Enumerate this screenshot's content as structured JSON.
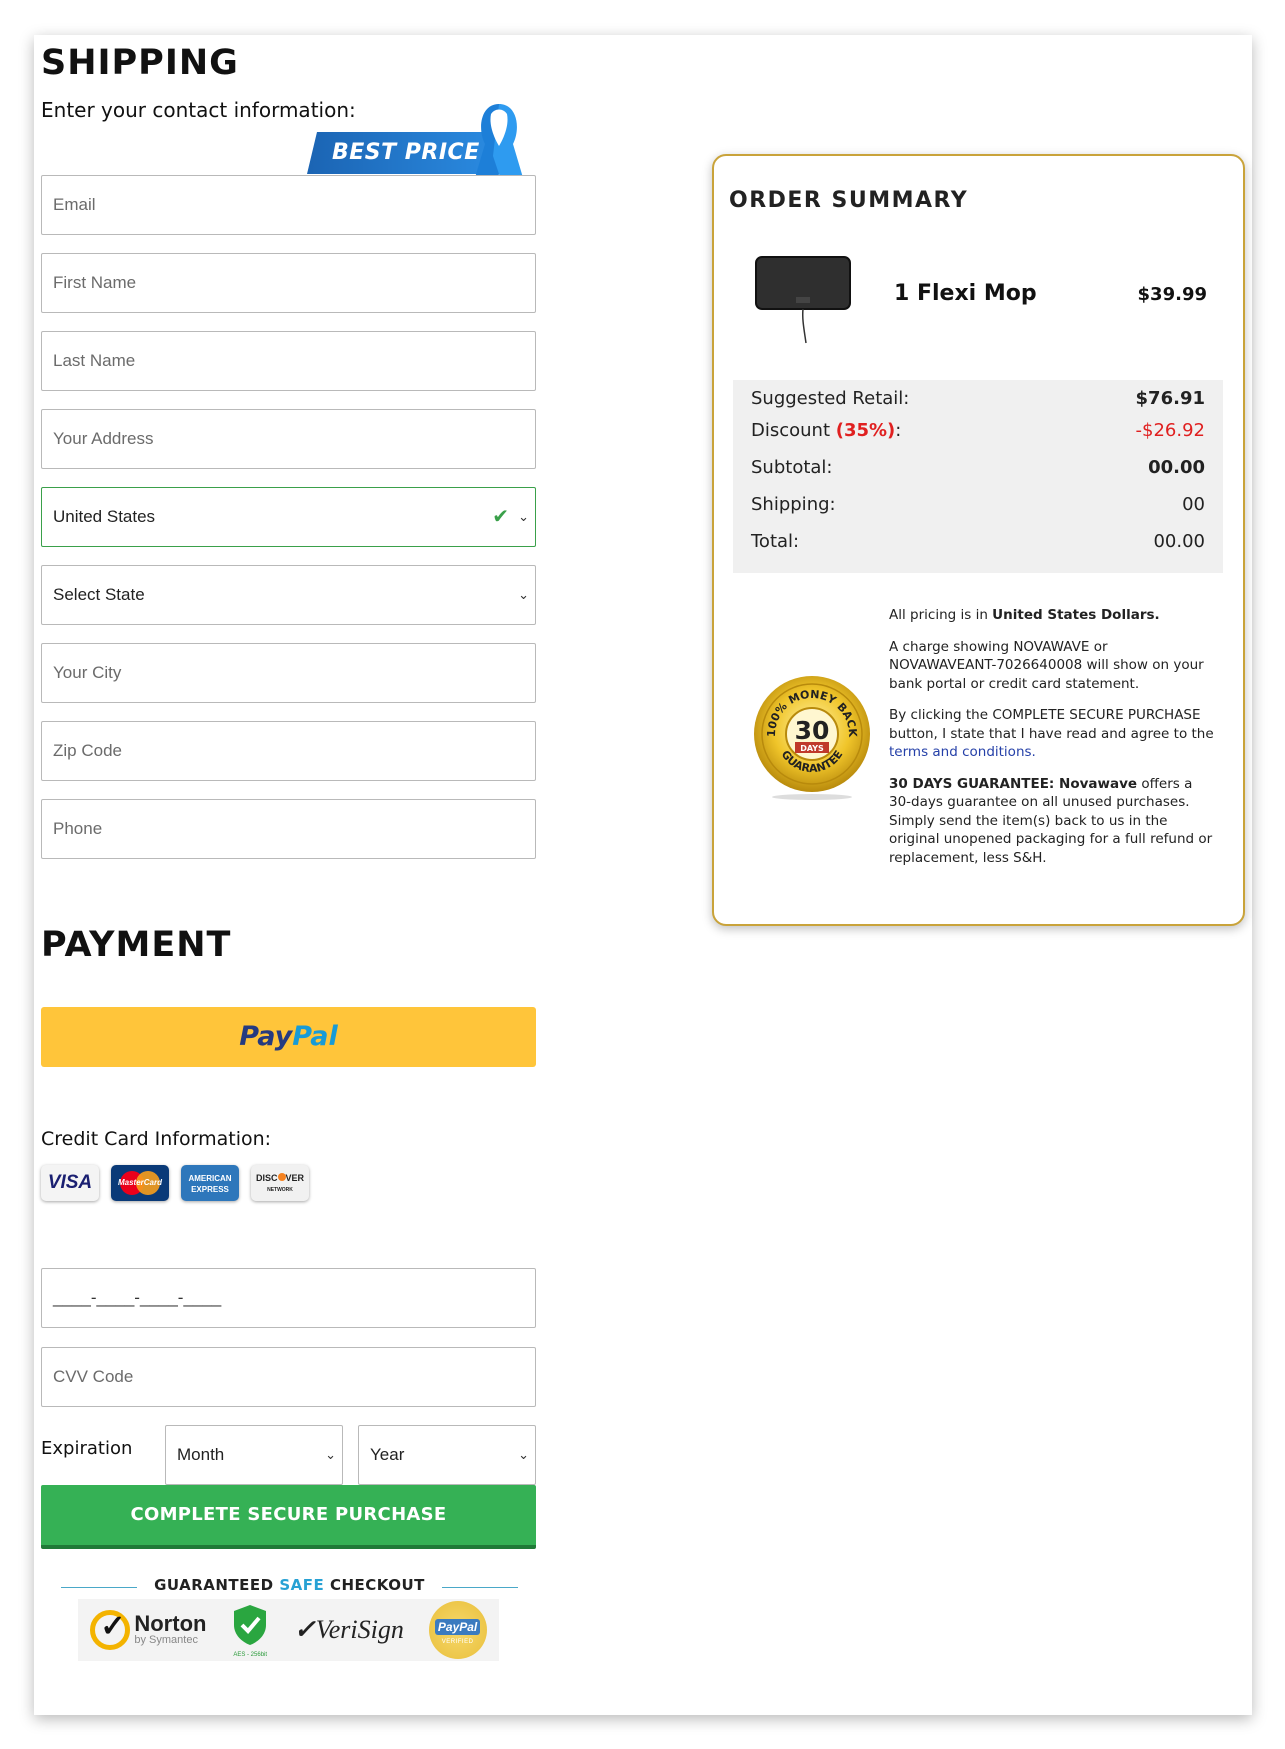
{
  "shipping": {
    "heading": "SHIPPING",
    "subtitle": "Enter your contact information:",
    "best_price": "BEST PRICE",
    "fields": {
      "email": "Email",
      "first_name": "First Name",
      "last_name": "Last Name",
      "address": "Your Address",
      "country": "United States",
      "state": "Select State",
      "city": "Your City",
      "zip": "Zip Code",
      "phone": "Phone"
    }
  },
  "payment": {
    "heading": "PAYMENT",
    "paypal_a": "Pay",
    "paypal_b": "Pal",
    "cc_label": "Credit Card Information:",
    "cards": [
      "VISA",
      "MasterCard",
      "AMERICAN EXPRESS",
      "DISCOVER"
    ],
    "amex_line1": "AMERICAN",
    "amex_line2": "EXPRESS",
    "discover_line1": "DISC",
    "discover_line2": "VER",
    "discover_sub": "NETWORK",
    "card_number_mask": "____-____-____-____",
    "cvv": "CVV Code",
    "expiration_label": "Expiration",
    "month": "Month",
    "year": "Year",
    "submit": "COMPLETE SECURE PURCHASE",
    "guaranteed_a": "GUARANTEED ",
    "guaranteed_safe": "SAFE",
    "guaranteed_b": " CHECKOUT",
    "trust": {
      "norton": "Norton",
      "norton_by": "by Symantec",
      "aes": "AES - 256bit",
      "verisign_a": "Veri",
      "verisign_b": "Sign",
      "paypal_verified_a": "PayPal",
      "paypal_verified_b": "VERIFIED"
    }
  },
  "summary": {
    "title": "ORDER SUMMARY",
    "product_name": "1 Flexi Mop",
    "product_price": "$39.99",
    "suggested_label": "Suggested Retail:",
    "suggested_value": "$76.91",
    "discount_label": "Discount ",
    "discount_pct": "(35%)",
    "discount_colon": ":",
    "discount_value": "-$26.92",
    "subtotal_label": "Subtotal:",
    "subtotal_value": "00.00",
    "shipping_label": "Shipping:",
    "shipping_value": "00",
    "total_label": "Total:",
    "total_value": "00.00",
    "badge": {
      "top": "100% MONEY BACK",
      "days_num": "30",
      "days": "DAYS",
      "bottom": "GUARANTEE"
    },
    "note1_a": "All pricing is in ",
    "note1_b": "United States Dollars.",
    "note2": "A charge showing NOVAWAVE or NOVAWAVEANT-7026640008 will show on your bank portal or credit card statement.",
    "note3_a": "By clicking the COMPLETE SECURE PURCHASE button, I state that I have read and agree to the ",
    "note3_link": "terms and conditions.",
    "note4_a": "30 DAYS GUARANTEE: Novawave",
    "note4_b": " offers a 30-days guarantee on all unused purchases. Simply send the item(s) back to us in the original unopened packaging for a full refund or replacement, less S&H."
  },
  "colors": {
    "paypal_yellow": "#ffc53a",
    "cta_green": "#35b155",
    "summary_border": "#c9a33a",
    "valid_green": "#3aa04a",
    "discount_red": "#e02020"
  },
  "icons": [
    "ribbon-icon",
    "check-icon",
    "chevron-down-icon",
    "norton-icon",
    "shield-check-icon",
    "verisign-icon",
    "paypal-verified-icon",
    "guarantee-seal-icon"
  ]
}
